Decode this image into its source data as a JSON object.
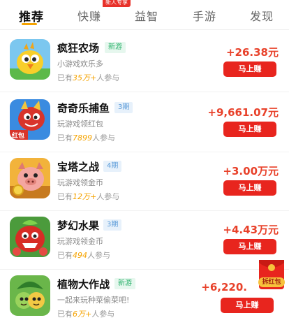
{
  "tabs": [
    {
      "label": "推荐",
      "active": true
    },
    {
      "label": "快赚",
      "active": false
    },
    {
      "label": "益智",
      "active": false
    },
    {
      "label": "手游",
      "active": false
    },
    {
      "label": "发现",
      "active": false
    }
  ],
  "tab_badge": "新人专享",
  "games": [
    {
      "title": "疯狂农场",
      "tag": "新游",
      "tag_type": "new",
      "subtitle": "小游戏欢乐多",
      "participants_prefix": "已有",
      "participants_count": "35万+",
      "participants_suffix": "人参与",
      "reward": "+26.38元",
      "button": "马上赚",
      "icon": "chick-icon"
    },
    {
      "title": "奇奇乐捕鱼",
      "tag": "3期",
      "tag_type": "period",
      "subtitle": "玩游戏领红包",
      "participants_prefix": "已有",
      "participants_count": "7899",
      "participants_suffix": "人参与",
      "reward": "+9,661.07元",
      "button": "马上赚",
      "icon": "dragon-icon",
      "icon_label": "红包"
    },
    {
      "title": "宝塔之战",
      "tag": "4期",
      "tag_type": "period",
      "subtitle": "玩游戏领金币",
      "participants_prefix": "已有",
      "participants_count": "12万+",
      "participants_suffix": "人参与",
      "reward": "+3.00万元",
      "button": "马上赚",
      "icon": "pig-warrior-icon"
    },
    {
      "title": "梦幻水果",
      "tag": "3期",
      "tag_type": "period",
      "subtitle": "玩游戏领金币",
      "participants_prefix": "已有",
      "participants_count": "494",
      "participants_suffix": "人参与",
      "reward": "+4.43万元",
      "button": "马上赚",
      "icon": "fruit-monster-icon"
    },
    {
      "title": "植物大作战",
      "tag": "新游",
      "tag_type": "new",
      "subtitle": "一起来玩种菜偷菜吧!",
      "participants_prefix": "已有",
      "participants_count": "6万+",
      "participants_suffix": "人参与",
      "reward": "+6,220.",
      "button": "马上赚",
      "icon": "plant-icon"
    }
  ],
  "floating_envelope": {
    "label": "拆红包",
    "icon": "red-envelope-icon"
  },
  "colors": {
    "accent": "#f5a300",
    "reward": "#e8412a",
    "button": "#e8251e",
    "new_tag": "#2bb26b",
    "period_tag": "#5b9bd8"
  }
}
